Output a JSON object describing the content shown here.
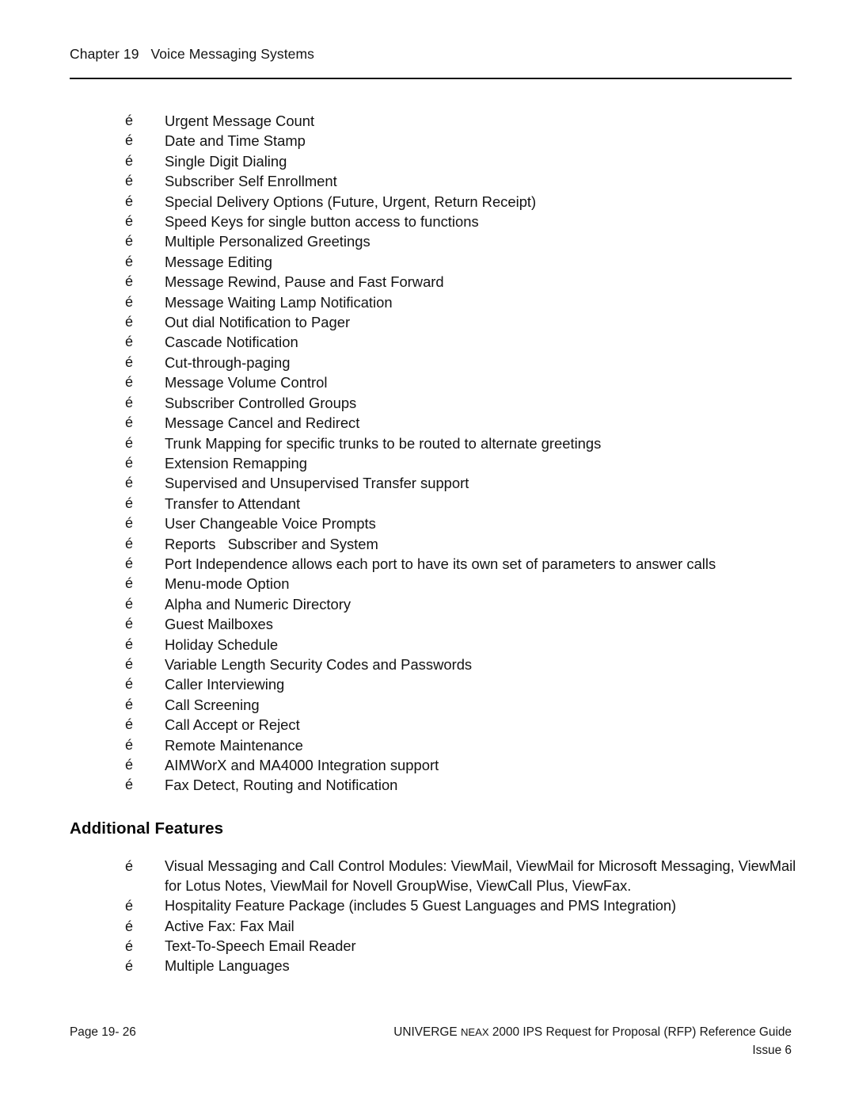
{
  "header": {
    "chapter_label": "Chapter 19",
    "chapter_title": "Voice Messaging Systems",
    "full_text": "Chapter 19   Voice Messaging Systems"
  },
  "bullet_glyph": "é",
  "main_list": {
    "items": [
      "Urgent Message Count",
      "Date and Time Stamp",
      "Single Digit Dialing",
      "Subscriber Self Enrollment",
      "Special Delivery Options (Future, Urgent, Return Receipt)",
      "Speed Keys for single button access to functions",
      "Multiple Personalized Greetings",
      "Message Editing",
      "Message Rewind, Pause and Fast Forward",
      "Message Waiting Lamp Notification",
      "Out dial Notification to Pager",
      "Cascade Notification",
      "Cut-through-paging",
      "Message Volume Control",
      "Subscriber Controlled Groups",
      "Message Cancel and Redirect",
      "Trunk Mapping for specific trunks to be routed to alternate greetings",
      "Extension Remapping",
      "Supervised and Unsupervised Transfer support",
      "Transfer to Attendant",
      "User Changeable Voice Prompts",
      "Reports   Subscriber and System",
      "Port Independence allows each port to have its own set of parameters to answer calls",
      "Menu-mode Option",
      "Alpha and Numeric Directory",
      "Guest Mailboxes",
      "Holiday Schedule",
      "Variable Length Security Codes and Passwords",
      "Caller Interviewing",
      "Call Screening",
      "Call Accept or Reject",
      "Remote Maintenance",
      "AIMWorX and MA4000 Integration support",
      "Fax Detect, Routing and Notification"
    ]
  },
  "additional_features": {
    "heading": "Additional Features",
    "items": [
      "Visual Messaging and Call Control Modules: ViewMail, ViewMail for Microsoft Messaging, ViewMail for Lotus Notes, ViewMail for Novell GroupWise, ViewCall Plus, ViewFax.",
      "Hospitality Feature Package (includes 5 Guest Languages and PMS Integration)",
      "Active Fax: Fax Mail",
      "Text-To-Speech Email Reader",
      "Multiple Languages"
    ]
  },
  "footer": {
    "page_number": "Page 19- 26",
    "guide_prefix": "UNIVERGE ",
    "guide_smallcaps": "NEAX",
    "guide_suffix": " 2000 IPS Request for Proposal (RFP) Reference Guide",
    "issue": "Issue 6"
  }
}
